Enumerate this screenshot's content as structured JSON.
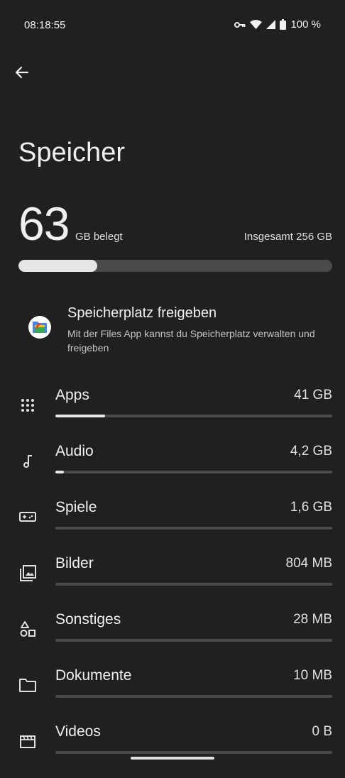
{
  "status_bar": {
    "time": "08:18:55",
    "battery": "100 %",
    "icons": [
      "vpn-key-icon",
      "wifi-icon",
      "cellular-signal-icon",
      "battery-icon"
    ]
  },
  "header": {
    "back_icon": "arrow-back-icon",
    "title": "Speicher"
  },
  "storage": {
    "used_value": "63",
    "used_unit": "GB belegt",
    "total": "Insgesamt 256 GB",
    "used_fraction": 0.25
  },
  "promo": {
    "icon": "files-app-icon",
    "title": "Speicherplatz freigeben",
    "description": "Mit der Files App kannst du Speicherplatz verwalten und freigeben"
  },
  "categories": [
    {
      "name": "Apps",
      "size": "41 GB",
      "icon": "apps-grid-icon",
      "fraction": 0.18
    },
    {
      "name": "Audio",
      "size": "4,2 GB",
      "icon": "music-note-icon",
      "fraction": 0.03
    },
    {
      "name": "Spiele",
      "size": "1,6 GB",
      "icon": "gamepad-icon",
      "fraction": 0.0
    },
    {
      "name": "Bilder",
      "size": "804 MB",
      "icon": "image-icon",
      "fraction": 0.0
    },
    {
      "name": "Sonstiges",
      "size": "28 MB",
      "icon": "shapes-icon",
      "fraction": 0.0
    },
    {
      "name": "Dokumente",
      "size": "10 MB",
      "icon": "folder-icon",
      "fraction": 0.0
    },
    {
      "name": "Videos",
      "size": "0 B",
      "icon": "movie-icon",
      "fraction": 0.0
    }
  ],
  "colors": {
    "background": "#202020",
    "bar_track": "#4a4a4a",
    "bar_fill": "#e6e6e6"
  }
}
